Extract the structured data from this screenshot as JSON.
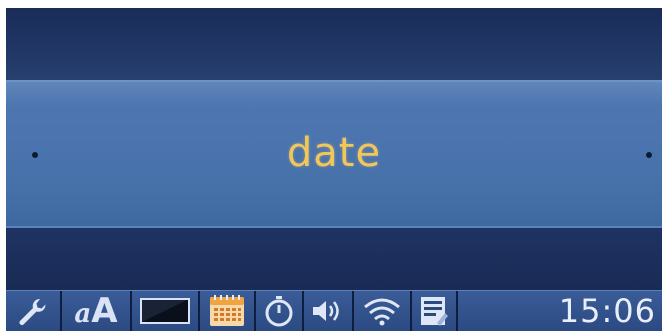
{
  "menu": {
    "label": "date"
  },
  "statusbar": {
    "icons": [
      {
        "name": "wrench-icon"
      },
      {
        "name": "font-size-icon",
        "text_small": "a",
        "text_big": "A"
      },
      {
        "name": "brightness-icon"
      },
      {
        "name": "calendar-icon"
      },
      {
        "name": "stopwatch-icon"
      },
      {
        "name": "volume-icon"
      },
      {
        "name": "wifi-icon"
      },
      {
        "name": "notepad-icon"
      }
    ],
    "time": "15:06"
  },
  "colors": {
    "menu_text": "#f2c75a",
    "menu_bar": "#4b74ae",
    "background": "#1b2a52",
    "statusbar": "#2c4a82",
    "calendar_accent": "#f0a640"
  }
}
